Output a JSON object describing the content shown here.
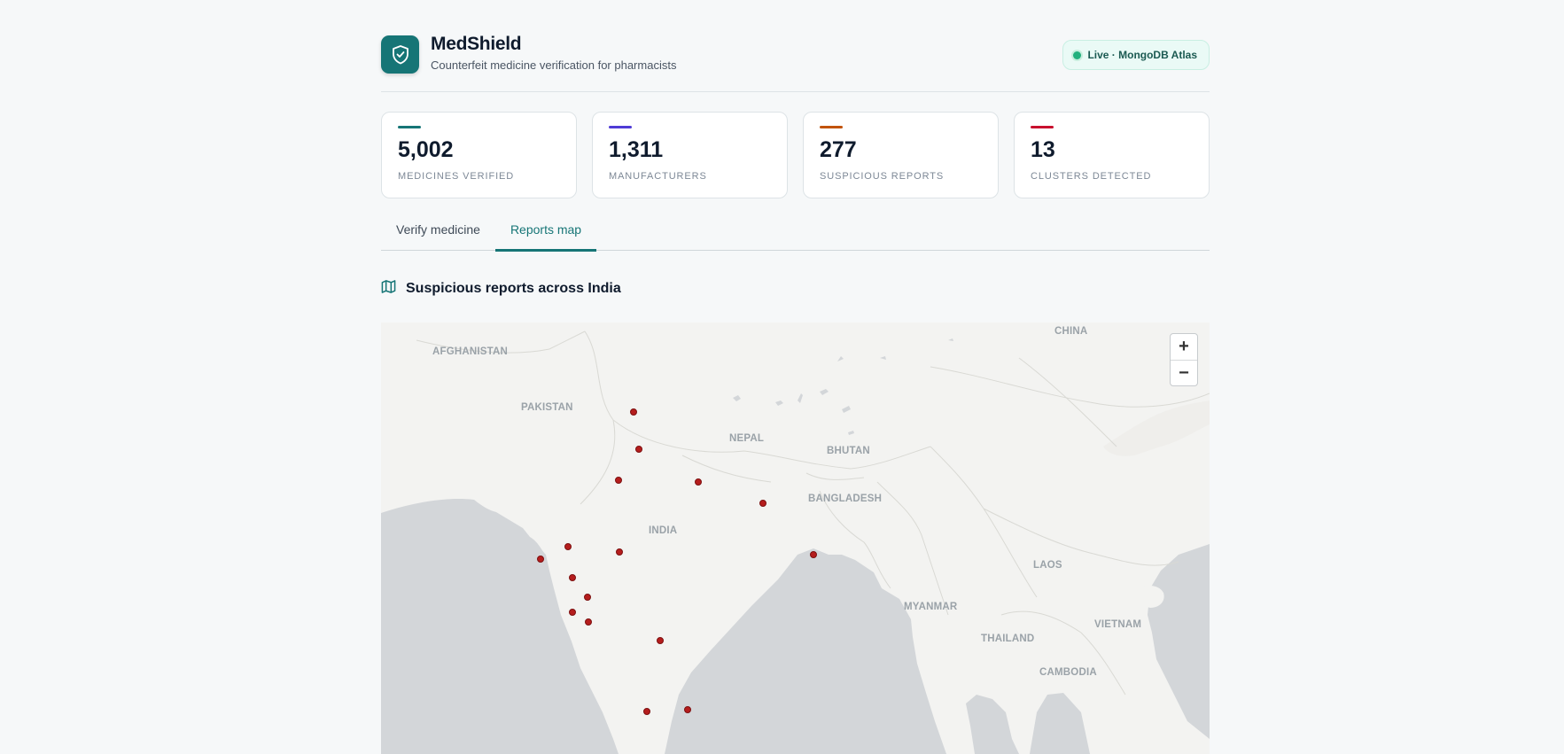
{
  "header": {
    "title": "MedShield",
    "tagline": "Counterfeit medicine verification for pharmacists",
    "status": "Live · MongoDB Atlas"
  },
  "stats": [
    {
      "value": "5,002",
      "label": "Medicines verified",
      "color": "#167576"
    },
    {
      "value": "1,311",
      "label": "Manufacturers",
      "color": "#4f3bd6"
    },
    {
      "value": "277",
      "label": "Suspicious reports",
      "color": "#c2530a"
    },
    {
      "value": "13",
      "label": "Clusters detected",
      "color": "#c8102e"
    }
  ],
  "tabs": [
    {
      "label": "Verify medicine",
      "active": false
    },
    {
      "label": "Reports map",
      "active": true
    }
  ],
  "section": {
    "title": "Suspicious reports across India",
    "icon": "map-icon"
  },
  "map": {
    "countries": [
      "AFGHANISTAN",
      "PAKISTAN",
      "NEPAL",
      "BHUTAN",
      "BANGLADESH",
      "INDIA",
      "CHINA",
      "MYANMAR",
      "LAOS",
      "THAILAND",
      "VIETNAM",
      "CAMBODIA"
    ],
    "zoom_in": "+",
    "zoom_out": "−",
    "marker_color": "#b51d1d"
  }
}
